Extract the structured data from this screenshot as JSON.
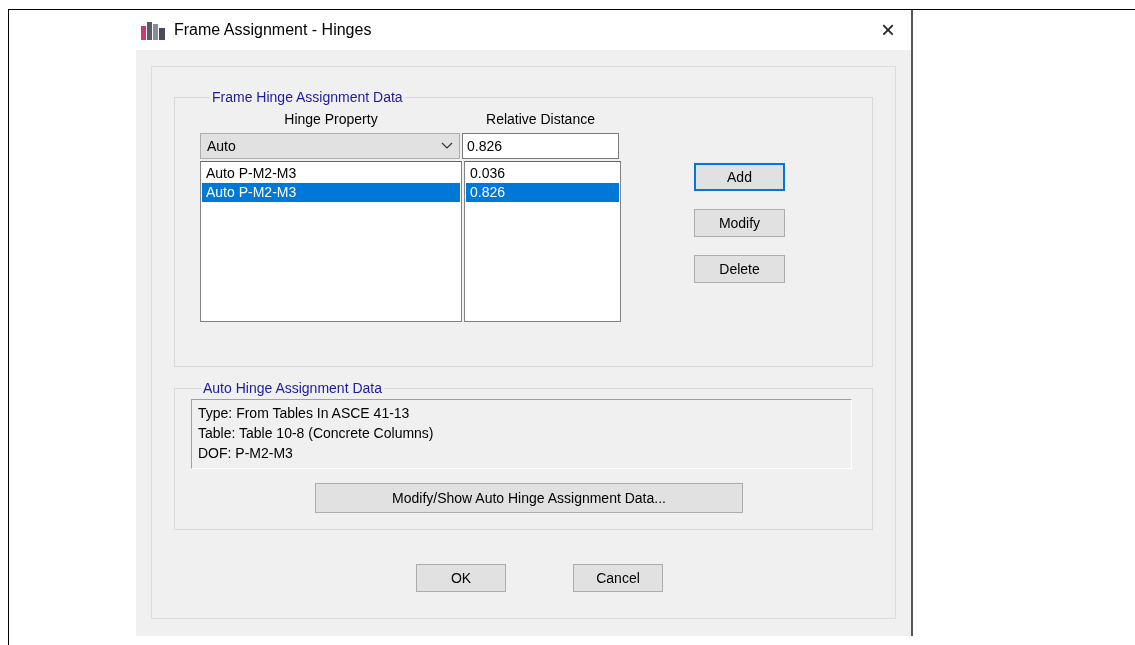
{
  "window": {
    "title": "Frame Assignment - Hinges",
    "close": "×"
  },
  "frame_hinge_group": {
    "title": "Frame Hinge Assignment Data",
    "columns": [
      "Hinge Property",
      "Relative Distance"
    ],
    "hinge_property": "Auto",
    "relative_distance": "0.826",
    "rows": [
      {
        "hinge": "Auto  P-M2-M3",
        "distance": "0.036",
        "selected": false
      },
      {
        "hinge": "Auto  P-M2-M3",
        "distance": "0.826",
        "selected": true
      }
    ],
    "buttons": [
      {
        "label": "Add",
        "focused": true
      },
      {
        "label": "Modify",
        "focused": false
      },
      {
        "label": "Delete",
        "focused": false
      }
    ]
  },
  "auto_hinge_group": {
    "title": "Auto Hinge Assignment Data",
    "lines": [
      "Type:  From Tables In ASCE 41-13",
      "Table:  Table 10-8 (Concrete Columns)",
      "DOF:  P-M2-M3"
    ],
    "button": "Modify/Show Auto Hinge Assignment Data..."
  },
  "buttons": [
    "OK",
    "Cancel"
  ]
}
